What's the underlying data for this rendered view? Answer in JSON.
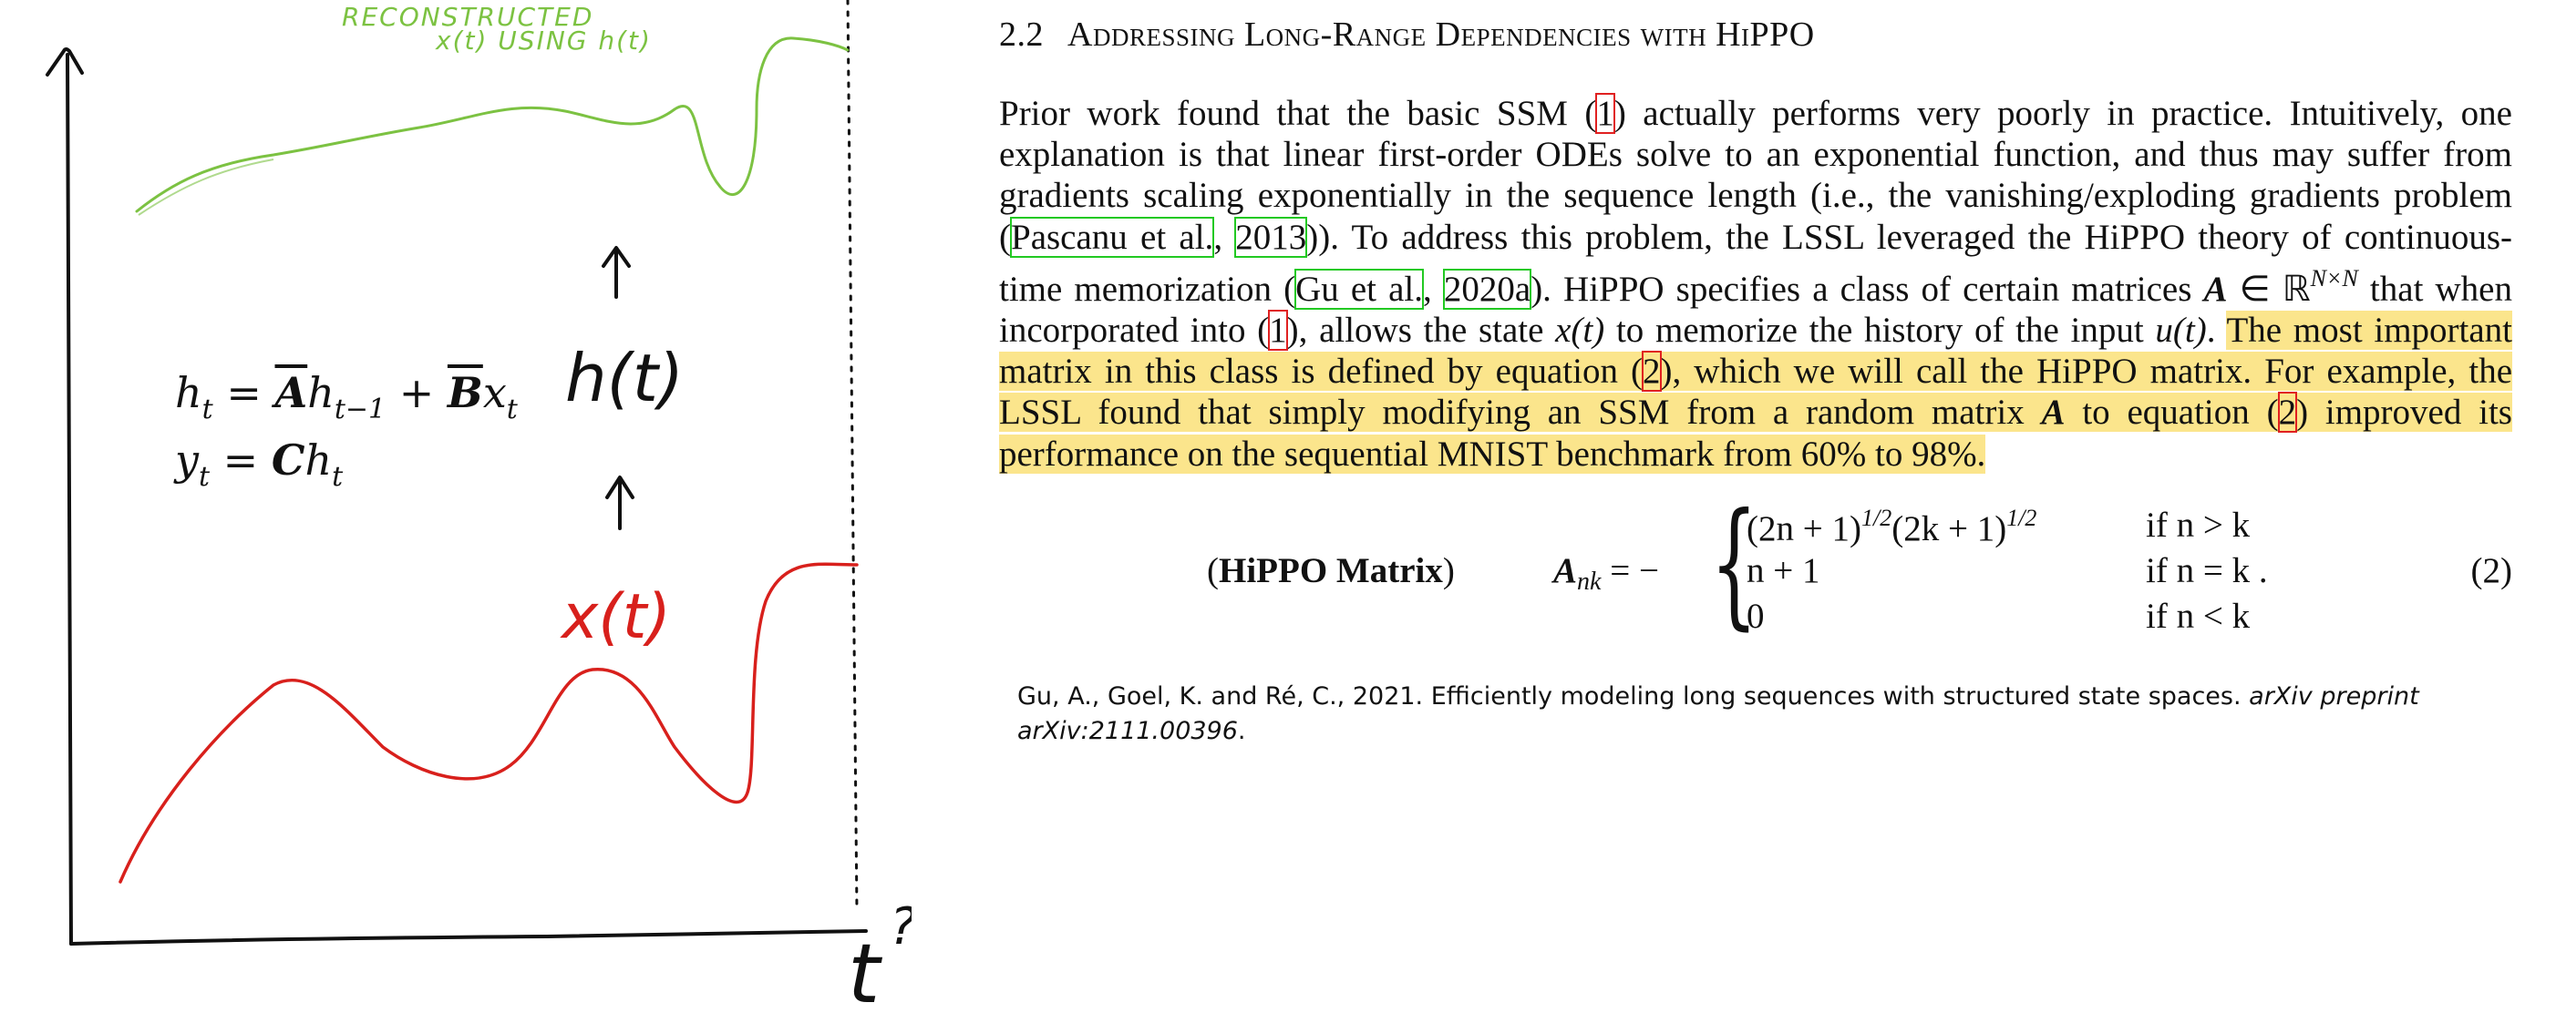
{
  "sketch": {
    "reconstructed_label_line1": "RECONSTRUCTED",
    "reconstructed_label_line2": "x(t) USING h(t)",
    "hidden_state_label": "h(t)",
    "input_label": "x(t)",
    "axis_label": "t",
    "axis_question": "?",
    "equation_line1": {
      "h": "h",
      "h_sub": "t",
      "equals": " = ",
      "A": "A",
      "h2": "h",
      "h2_sub": "t−1",
      "plus": " + ",
      "B": "B",
      "x": "x",
      "x_sub": "t"
    },
    "equation_line2": {
      "y": "y",
      "y_sub": "t",
      "equals": " = ",
      "C": "C",
      "h": "h",
      "h_sub": "t"
    },
    "colors": {
      "ink": "#111111",
      "reconstructed": "#7cc242",
      "input": "#d8201c"
    }
  },
  "paper": {
    "section_number": "2.2",
    "section_title": "Addressing Long-Range Dependencies with HiPPO",
    "paragraph": {
      "t1": "Prior work found that the basic SSM (",
      "ref1": "1",
      "t2": ") actually performs very poorly in practice. Intuitively, one explanation is that linear first-order ODEs solve to an exponential function, and thus may suffer from gradients scaling exponentially in the sequence length (i.e., the vanishing/exploding gradients problem (",
      "cite_pascanu": "Pascanu et al.",
      "cite_sep1": ", ",
      "cite_2013": "2013",
      "t3": ")). To address this problem, the LSSL leveraged the HiPPO theory of continuous-time memorization (",
      "cite_gu": "Gu et al.",
      "cite_sep2": ", ",
      "cite_2020a": "2020a",
      "t4": "). HiPPO specifies a class of certain matrices ",
      "A1": "A",
      "in_R": " ∈ ℝ",
      "sup_NxN": "N×N",
      "t5": " that when incorporated into (",
      "ref1b": "1",
      "t6": "), allows the state ",
      "xt": "x(t)",
      "t7": " to memorize the history of the input ",
      "ut": "u(t)",
      "t8": ". ",
      "hl1": "The most important matrix in this class is defined by equation (",
      "ref2": "2",
      "hl2": "), which we will call the HiPPO matrix. For example, the LSSL found that simply modifying an SSM from a random matrix ",
      "A2": "A",
      "hl3": " to equation (",
      "ref2b": "2",
      "hl4": ") improved its performance on the sequential MNIST benchmark from 60% to 98%."
    },
    "equation": {
      "label_open": "(",
      "label_bold": "HiPPO Matrix",
      "label_close": ")",
      "lhs": "A",
      "lhs_sub": "nk",
      "lhs_eq": " = −",
      "brace": "{",
      "case1_expr": "(2n + 1)",
      "case1_sup1": "1/2",
      "case1_mid": "(2k + 1)",
      "case1_sup2": "1/2",
      "case1_cond": "if n > k",
      "case2_expr": "n + 1",
      "case2_cond": "if n = k .",
      "case3_expr": "0",
      "case3_cond": "if n < k",
      "number": "(2)"
    },
    "citation": {
      "authors_title": "Gu, A., Goel, K. and Ré, C., 2021. Efficiently modeling long sequences with structured state spaces. ",
      "journal": "arXiv preprint arXiv:2111.00396",
      "end": "."
    }
  }
}
